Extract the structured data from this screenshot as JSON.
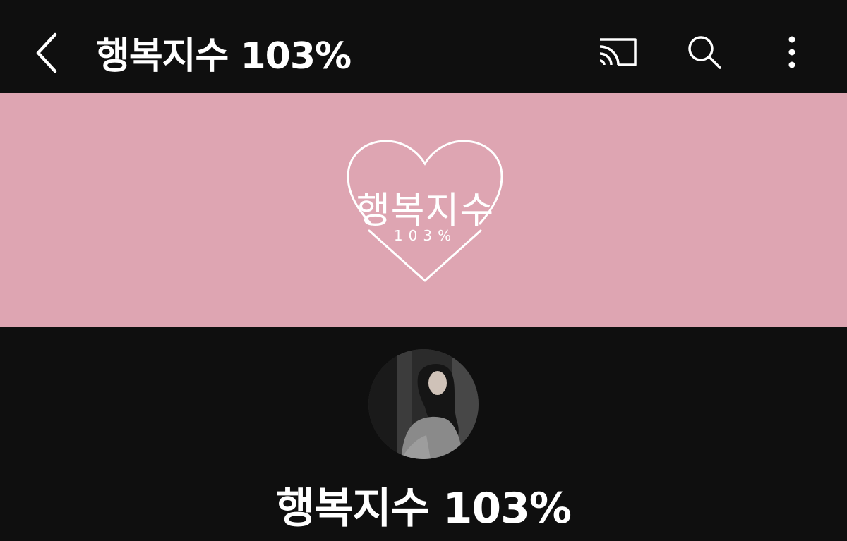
{
  "header": {
    "title": "행복지수 103%",
    "back_icon": "chevron-left-icon",
    "cast_icon": "cast-icon",
    "search_icon": "search-icon",
    "more_icon": "more-vertical-icon"
  },
  "banner": {
    "background_color": "#dea5b2",
    "logo_text": "행복지수",
    "logo_number": "103%",
    "logo_icon": "heart-outline-icon"
  },
  "channel": {
    "name": "행복지수 103%",
    "avatar_icon": "profile-photo"
  },
  "colors": {
    "background": "#0f0f0f",
    "text": "#ffffff"
  }
}
